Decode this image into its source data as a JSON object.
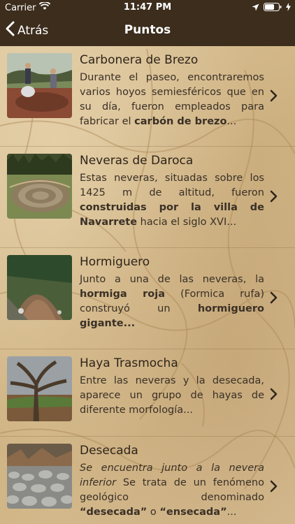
{
  "status": {
    "carrier": "Carrier",
    "time": "11:47 PM"
  },
  "nav": {
    "back_label": "Atrás",
    "title": "Puntos"
  },
  "items": [
    {
      "title": "Carbonera de Brezo",
      "desc_parts": [
        {
          "t": "Durante el paseo, encontraremos varios hoyos semiesféricos que en su día, fueron empleados para fabricar el ",
          "s": "normal"
        },
        {
          "t": "carbón de brezo",
          "s": "bold"
        },
        {
          "t": "...",
          "s": "normal"
        }
      ]
    },
    {
      "title": "Neveras de Daroca",
      "desc_parts": [
        {
          "t": "Estas neveras, situadas sobre los 1425 m de altitud, fueron ",
          "s": "normal"
        },
        {
          "t": "construidas por la villa de Navarrete",
          "s": "bold"
        },
        {
          "t": " hacia el siglo XVI...",
          "s": "normal"
        }
      ]
    },
    {
      "title": "Hormiguero",
      "desc_parts": [
        {
          "t": "Junto a una de las neveras, la ",
          "s": "normal"
        },
        {
          "t": "hormiga roja",
          "s": "bold"
        },
        {
          "t": " (Formica rufa) construyó un ",
          "s": "normal"
        },
        {
          "t": "hormiguero gigante...",
          "s": "bold"
        }
      ]
    },
    {
      "title": "Haya Trasmocha",
      "desc_parts": [
        {
          "t": "Entre las neveras y la desecada, aparece un grupo de hayas de diferente morfología...",
          "s": "normal"
        }
      ]
    },
    {
      "title": "Desecada",
      "desc_parts": [
        {
          "t": "Se encuentra junto a la nevera inferior",
          "s": "italic"
        },
        {
          "t": " Se trata de un fenómeno geológico denominado ",
          "s": "normal"
        },
        {
          "t": "“desecada”",
          "s": "bold"
        },
        {
          "t": " o ",
          "s": "normal"
        },
        {
          "t": "“ensecada”",
          "s": "bold"
        },
        {
          "t": "...",
          "s": "normal"
        }
      ]
    }
  ],
  "colors": {
    "nav_bg": "#3c2d1d",
    "bg": "#d9c29a",
    "text": "#2e241a"
  }
}
